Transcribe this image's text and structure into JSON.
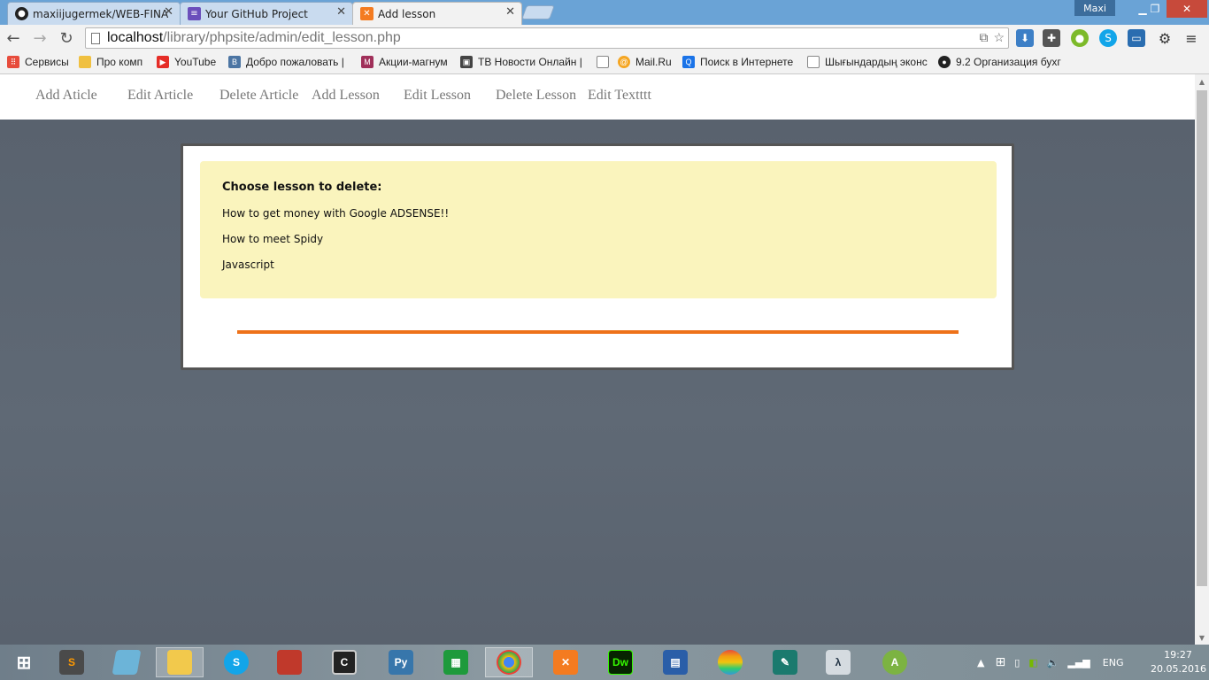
{
  "browser": {
    "tabs": [
      {
        "title": "maxiijugermek/WEB-FINA",
        "icon": "github-icon",
        "active": false
      },
      {
        "title": "Your GitHub Project",
        "icon": "list-icon",
        "active": false
      },
      {
        "title": "Add lesson",
        "icon": "xampp-icon",
        "active": true
      }
    ],
    "user": "Maxi",
    "url_host": "localhost",
    "url_path": "/library/phpsite/admin/edit_lesson.php",
    "bookmarks": [
      "Сервисы",
      "Про комп",
      "YouTube",
      "Добро пожаловать |",
      "Акции-магнум",
      "ТВ Новости Онлайн |",
      "Mail.Ru",
      "Поиск в Интернете",
      "Шығындардың эконс",
      "9.2 Организация бухг"
    ]
  },
  "nav": {
    "items": [
      "Add Aticle",
      "Edit Article",
      "Delete Article",
      "Add Lesson",
      "Edit Lesson",
      "Delete Lesson",
      "Edit Textttt"
    ]
  },
  "main": {
    "heading": "Choose lesson to delete:",
    "lessons": [
      "How to get money with Google ADSENSE!!",
      "How to meet Spidy",
      "Javascript"
    ]
  },
  "taskbar": {
    "language": "ENG",
    "time": "19:27",
    "date": "20.05.2016"
  },
  "colors": {
    "accent_orange": "#ee7219",
    "notice_bg": "#faf4bd",
    "page_bg": "#5b6470"
  }
}
